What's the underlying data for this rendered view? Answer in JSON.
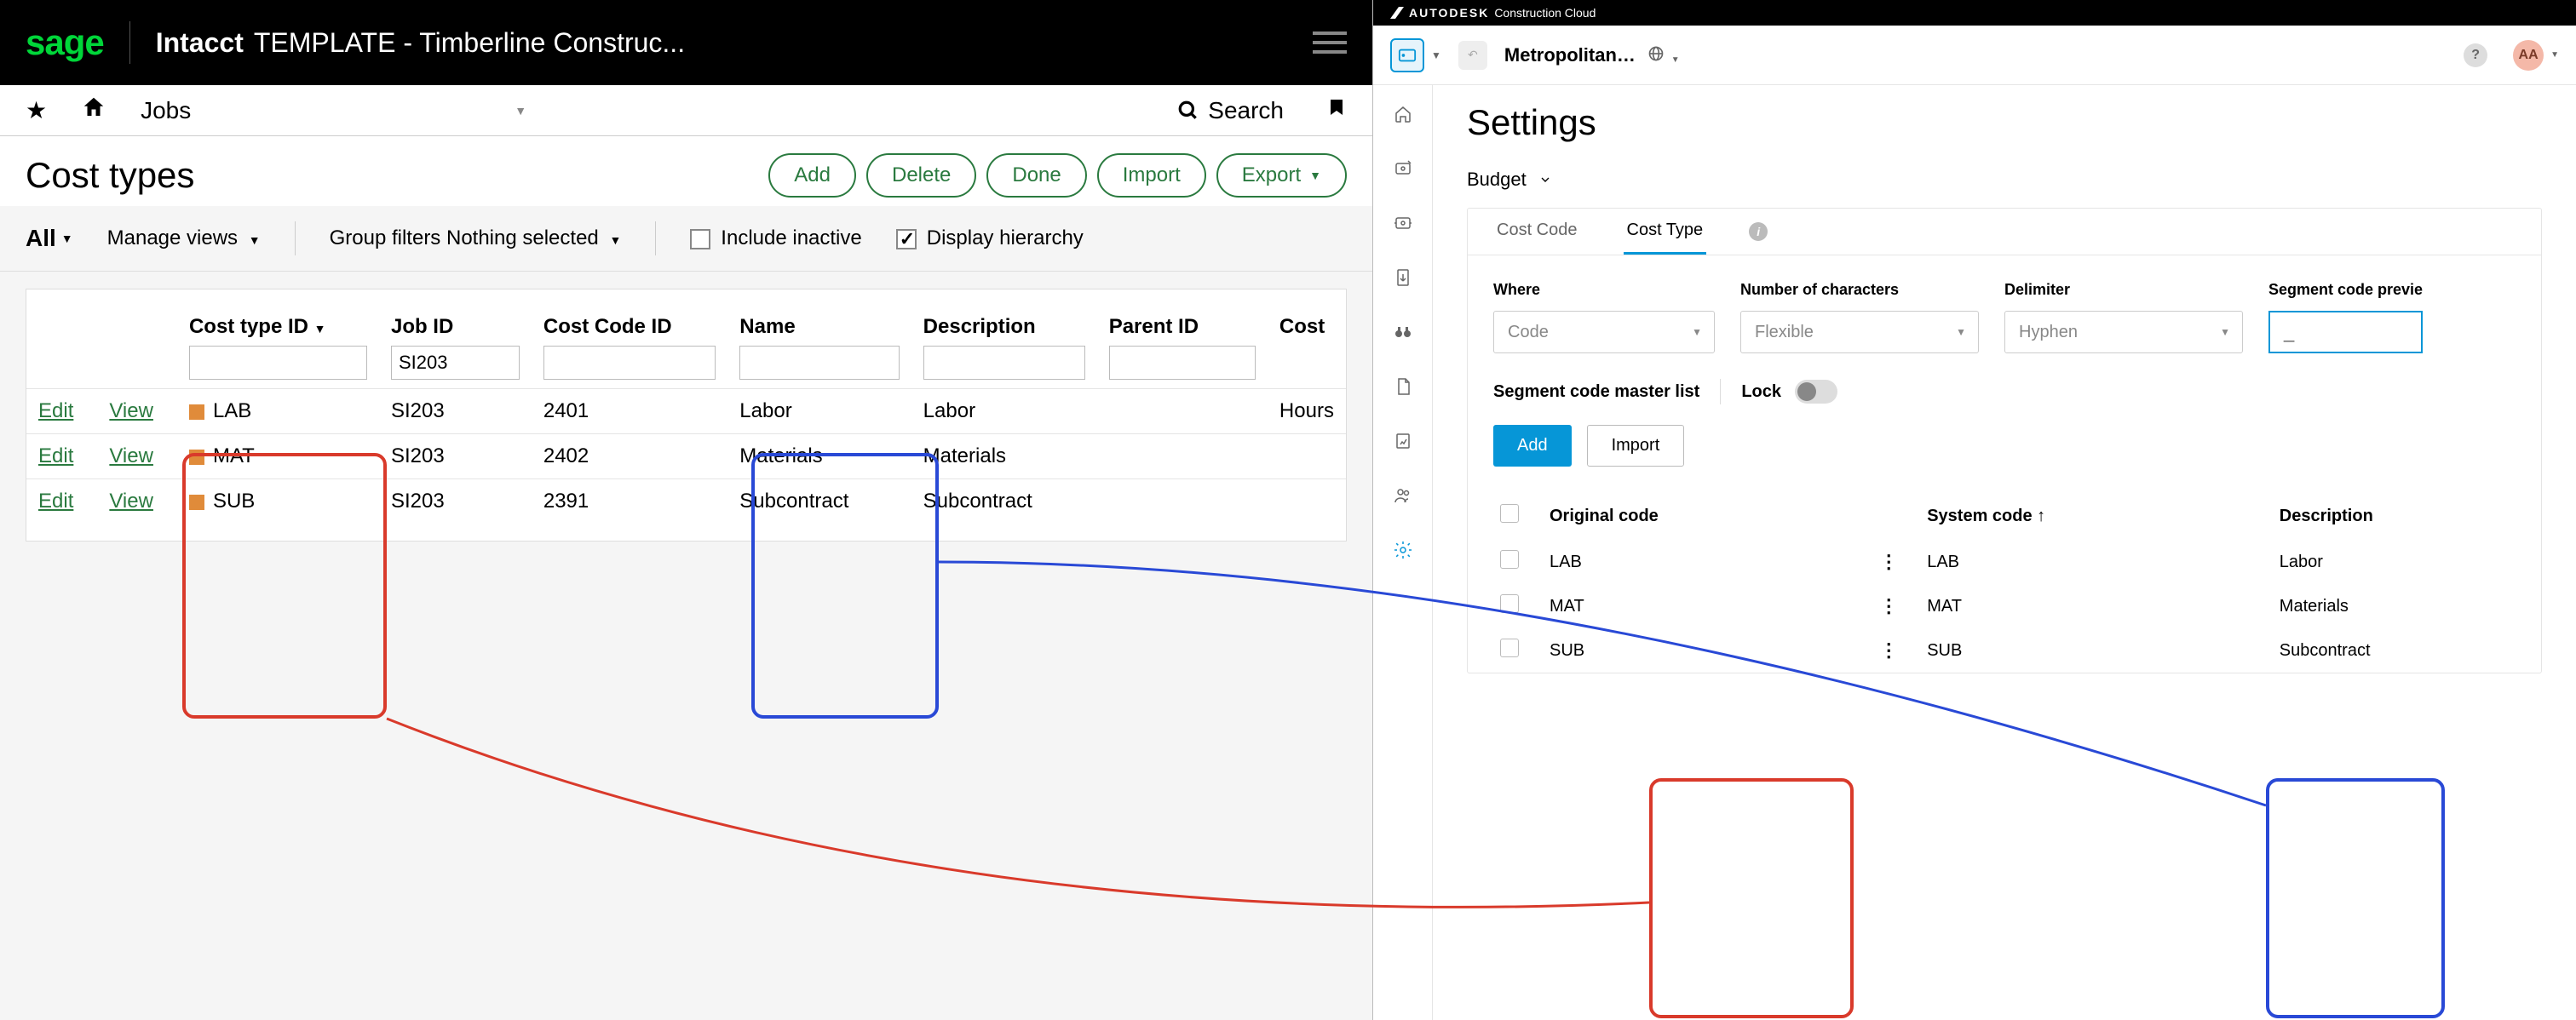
{
  "sage": {
    "logo": "sage",
    "product": "Intacct",
    "template": "TEMPLATE - Timberline Construc...",
    "nav": {
      "module": "Jobs",
      "search": "Search"
    },
    "page_title": "Cost types",
    "actions": {
      "add": "Add",
      "delete": "Delete",
      "done": "Done",
      "import": "Import",
      "export": "Export"
    },
    "filter": {
      "all": "All",
      "manage_views": "Manage views",
      "group_filters": "Group filters",
      "nothing_selected": "Nothing selected",
      "include_inactive": "Include inactive",
      "display_hierarchy": "Display hierarchy"
    },
    "columns": {
      "cost_type_id": "Cost type ID",
      "job_id": "Job ID",
      "cost_code_id": "Cost Code ID",
      "name": "Name",
      "description": "Description",
      "parent_id": "Parent ID",
      "cost": "Cost"
    },
    "job_id_filter_value": "SI203",
    "rows": [
      {
        "edit": "Edit",
        "view": "View",
        "cost_type_id": "LAB",
        "job_id": "SI203",
        "cost_code_id": "2401",
        "name": "Labor",
        "description": "Labor",
        "parent_id": "",
        "cost": "Hours"
      },
      {
        "edit": "Edit",
        "view": "View",
        "cost_type_id": "MAT",
        "job_id": "SI203",
        "cost_code_id": "2402",
        "name": "Materials",
        "description": "Materials",
        "parent_id": "",
        "cost": ""
      },
      {
        "edit": "Edit",
        "view": "View",
        "cost_type_id": "SUB",
        "job_id": "SI203",
        "cost_code_id": "2391",
        "name": "Subcontract",
        "description": "Subcontract",
        "parent_id": "",
        "cost": ""
      }
    ]
  },
  "acc": {
    "brand": "AUTODESK",
    "brand_sub": "Construction Cloud",
    "project": "Metropolitan…",
    "avatar": "AA",
    "title": "Settings",
    "section": "Budget",
    "tabs": {
      "cost_code": "Cost Code",
      "cost_type": "Cost Type"
    },
    "seg": {
      "where_label": "Where",
      "where_value": "Code",
      "num_label": "Number of characters",
      "num_value": "Flexible",
      "delim_label": "Delimiter",
      "delim_value": "Hyphen",
      "preview_label": "Segment code previe",
      "preview_value": "_"
    },
    "master_list": "Segment code master list",
    "lock": "Lock",
    "btn_add": "Add",
    "btn_import": "Import",
    "tcols": {
      "orig": "Original code",
      "sys": "System code",
      "desc": "Description"
    },
    "trows": [
      {
        "orig": "LAB",
        "sys": "LAB",
        "desc": "Labor"
      },
      {
        "orig": "MAT",
        "sys": "MAT",
        "desc": "Materials"
      },
      {
        "orig": "SUB",
        "sys": "SUB",
        "desc": "Subcontract"
      }
    ]
  }
}
